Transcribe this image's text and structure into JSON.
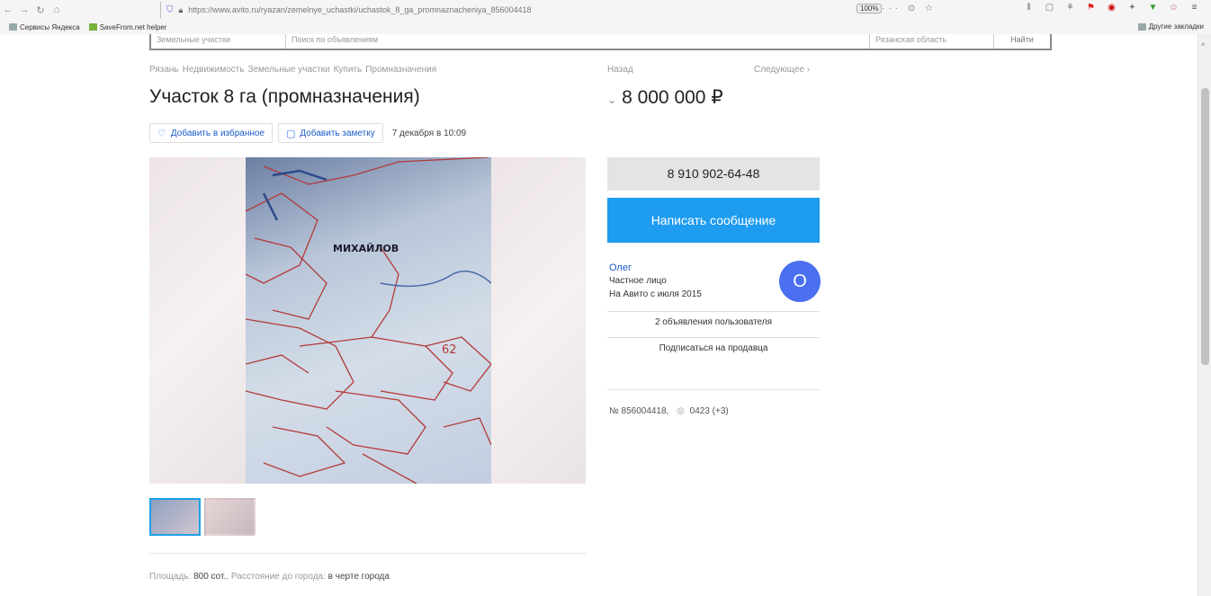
{
  "browser": {
    "url": "https://www.avito.ru/ryazan/zemelnye_uchastki/uchastok_8_ga_promnaznacheniya_856004418",
    "zoom": "100%",
    "right_icons": "··· ⊙ ☆"
  },
  "bookmarks": {
    "items": [
      {
        "label": "Сервисы Яндекса"
      },
      {
        "label": "SaveFrom.net helper"
      }
    ],
    "other": "Другие закладки"
  },
  "search": {
    "category": "Земельные участки",
    "query_placeholder": "Поиск по объявлениям",
    "region": "Рязанская область",
    "button": "Найти"
  },
  "breadcrumbs": [
    "Рязань",
    "Недвижимость",
    "Земельные участки",
    "Купить",
    "Промназначения"
  ],
  "nav": {
    "prev": "Назад",
    "next": "Следующее ›"
  },
  "listing": {
    "title": "Участок 8 га (промназначения)",
    "price": "8 000 000 ₽",
    "add_favorite": "Добавить в избранное",
    "add_note": "Добавить заметку",
    "date": "7 декабря в 10:09",
    "params_label": "Площадь:",
    "params_area": "800 сот.",
    "params_distance_label": "Расстояние до города:",
    "params_distance": "в черте города"
  },
  "contact": {
    "phone": "8 910 902-64-48",
    "message": "Написать сообщение",
    "seller_name": "Олег",
    "seller_type": "Частное лицо",
    "seller_since": "На Авито с июля 2015",
    "avatar_letter": "О",
    "user_ads": "2 объявления пользователя",
    "subscribe": "Подписаться на продавца"
  },
  "meta": {
    "ad_number": "№ 856004418,",
    "views": "0423 (+3)"
  },
  "colors": {
    "accent": "#1e9cf0",
    "avatar": "#4a6ff0",
    "link": "#1a5cc7"
  }
}
